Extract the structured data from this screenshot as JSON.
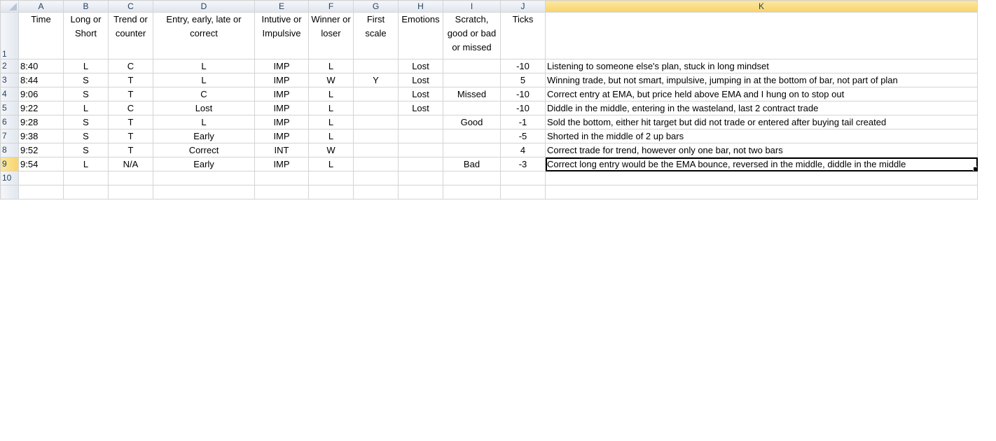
{
  "columns": [
    "A",
    "B",
    "C",
    "D",
    "E",
    "F",
    "G",
    "H",
    "I",
    "J",
    "K"
  ],
  "active_column": "K",
  "active_row": "9",
  "header_row": {
    "row": "1",
    "cells": [
      "Time",
      "Long or Short",
      "Trend or counter",
      "Entry, early, late or correct",
      "Intutive or Impulsive",
      "Winner or loser",
      "First scale",
      "Emotions",
      "Scratch, good or bad or missed",
      "Ticks",
      ""
    ]
  },
  "rows": [
    {
      "row": "2",
      "cells": [
        "8:40",
        "L",
        "C",
        "L",
        "IMP",
        "L",
        "",
        "Lost",
        "",
        "-10",
        "Listening to someone else's plan, stuck in long mindset"
      ]
    },
    {
      "row": "3",
      "cells": [
        "8:44",
        "S",
        "T",
        "L",
        "IMP",
        "W",
        "Y",
        "Lost",
        "",
        "5",
        "Winning trade, but not smart, impulsive, jumping in at the bottom of bar, not part of plan"
      ]
    },
    {
      "row": "4",
      "cells": [
        "9:06",
        "S",
        "T",
        "C",
        "IMP",
        "L",
        "",
        "Lost",
        "Missed",
        "-10",
        "Correct entry at EMA, but price held above EMA and I hung on to stop out"
      ]
    },
    {
      "row": "5",
      "cells": [
        "9:22",
        "L",
        "C",
        "Lost",
        "IMP",
        "L",
        "",
        "Lost",
        "",
        "-10",
        "Diddle in the middle, entering in the wasteland, last 2 contract trade"
      ]
    },
    {
      "row": "6",
      "cells": [
        "9:28",
        "S",
        "T",
        "L",
        "IMP",
        "L",
        "",
        "",
        "Good",
        "-1",
        "Sold the bottom, either hit target but did not trade or entered after buying tail created"
      ]
    },
    {
      "row": "7",
      "cells": [
        "9:38",
        "S",
        "T",
        "Early",
        "IMP",
        "L",
        "",
        "",
        "",
        "-5",
        "Shorted in the middle of 2 up bars"
      ]
    },
    {
      "row": "8",
      "cells": [
        "9:52",
        "S",
        "T",
        "Correct",
        "INT",
        "W",
        "",
        "",
        "",
        "4",
        "Correct trade for trend, however only one bar, not two bars"
      ]
    },
    {
      "row": "9",
      "cells": [
        "9:54",
        "L",
        "N/A",
        "Early",
        "IMP",
        "L",
        "",
        "",
        "Bad",
        "-3",
        "Correct long entry would be the EMA bounce, reversed in the middle, diddle in the middle"
      ]
    },
    {
      "row": "10",
      "cells": [
        "",
        "",
        "",
        "",
        "",
        "",
        "",
        "",
        "",
        "",
        ""
      ]
    },
    {
      "row": "",
      "cells": [
        "",
        "",
        "",
        "",
        "",
        "",
        "",
        "",
        "",
        "",
        ""
      ]
    }
  ],
  "colors": {
    "active_header": "#f8d36b",
    "header_text": "#27415f",
    "gridline": "#d4d4d4"
  }
}
